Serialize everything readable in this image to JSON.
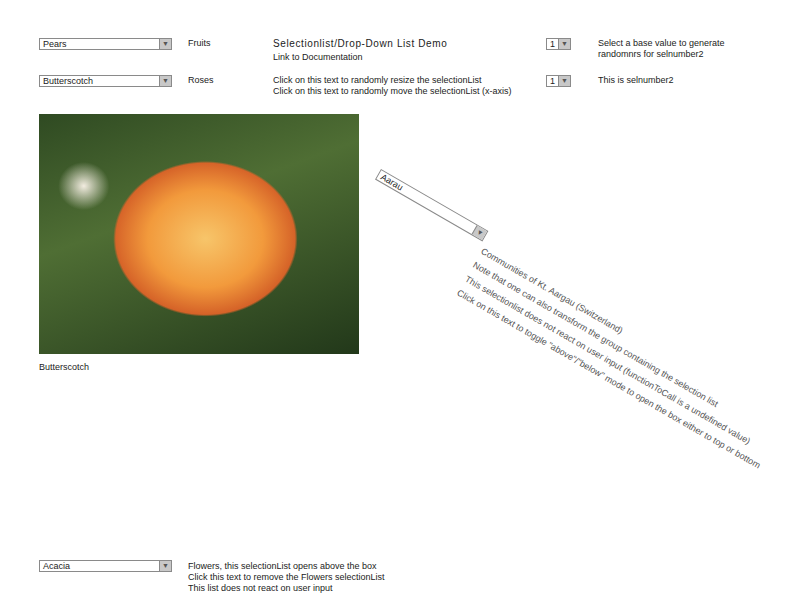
{
  "page": {
    "title": "Selectionlist/Drop-Down List Demo"
  },
  "arrow": "▼",
  "rows": [
    {
      "select": "Pears",
      "label": "Fruits",
      "center": [
        {
          "text": "Selectionlist/Drop-Down List Demo",
          "kind": "title"
        },
        {
          "text": "Link to Documentation",
          "kind": "link"
        }
      ],
      "number": "1",
      "numberNotes": [
        "Select a base value to generate",
        "randomnrs for selnumber2"
      ]
    },
    {
      "select": "Butterscotch",
      "label": "Roses",
      "center": [
        {
          "text": "Click on this text to randomly resize the selectionList",
          "kind": "note"
        },
        {
          "text": "Click on this text to randomly move the selectionList (x-axis)",
          "kind": "note"
        }
      ],
      "number": "1",
      "numberNotes": [
        "This is selnumber2"
      ]
    }
  ],
  "photo": {
    "caption": "Butterscotch"
  },
  "aargau": {
    "select": "Aarau",
    "notes": [
      "Communities of Kt. Aargau (Switzerland)",
      "Note that one can also transform the group containing the selection list",
      "This selectionlist does not react on user input (functionToCall is a undefined value)",
      "Click on this text to toggle \"above\"/\"below\" mode to open the box either to top or bottom"
    ]
  },
  "flowers": {
    "select": "Acacia",
    "notes": [
      "Flowers, this selectionList opens above the box",
      "Click this text to remove the Flowers selectionList",
      "This list does not react on user input"
    ]
  }
}
